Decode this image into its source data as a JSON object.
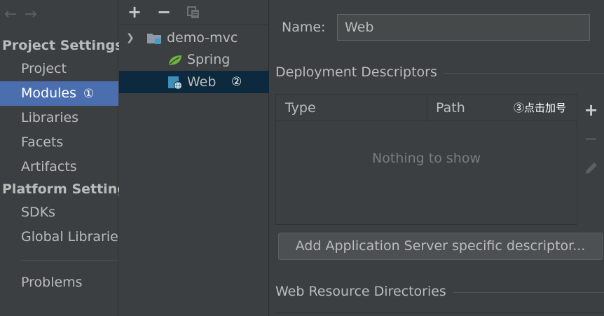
{
  "nav": {
    "back_arrow": "←",
    "forward_arrow": "→",
    "sections": [
      {
        "title": "Project Settings",
        "items": [
          "Project",
          "Modules",
          "Libraries",
          "Facets",
          "Artifacts"
        ]
      },
      {
        "title": "Platform Setting",
        "items": [
          "SDKs",
          "Global Librarie"
        ]
      }
    ],
    "selected": "Modules",
    "annotation_1": "①",
    "problems": "Problems"
  },
  "tree": {
    "toolbar": {
      "add": "+",
      "remove": "−"
    },
    "root": "demo-mvc",
    "children": [
      "Spring",
      "Web"
    ],
    "selected": "Web",
    "annotation_2": "②"
  },
  "detail": {
    "name_label": "Name:",
    "name_value": "Web",
    "deployment_title": "Deployment Descriptors",
    "columns": [
      "Type",
      "Path"
    ],
    "empty_text": "Nothing to show",
    "annotation_3": "③点击加号",
    "side_tools": {
      "add": "+",
      "remove": "−"
    },
    "add_server_button": "Add Application Server specific descriptor...",
    "web_resource_title": "Web Resource Directories"
  },
  "colors": {
    "background": "#3c3f41",
    "nav_selected": "#4b6eaf",
    "tree_selected": "#0d293e",
    "spring_green": "#6db33f",
    "web_blue": "#3d8fb8"
  }
}
